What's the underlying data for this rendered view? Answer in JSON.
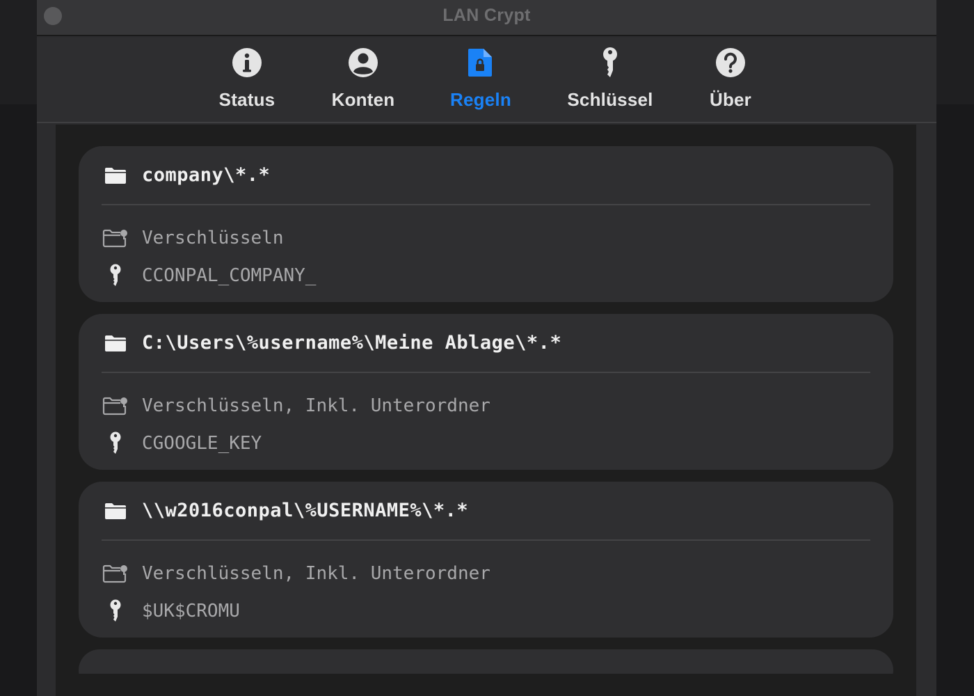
{
  "window": {
    "title": "LAN Crypt"
  },
  "toolbar": {
    "tabs": [
      {
        "label": "Status",
        "icon": "info-circle-icon"
      },
      {
        "label": "Konten",
        "icon": "person-circle-icon"
      },
      {
        "label": "Regeln",
        "icon": "doc-lock-icon",
        "active": true
      },
      {
        "label": "Schlüssel",
        "icon": "key-icon"
      },
      {
        "label": "Über",
        "icon": "question-circle-icon"
      }
    ]
  },
  "rules": [
    {
      "path": "company\\*.*",
      "action": "Verschlüsseln",
      "key": "CCONPAL_COMPANY_"
    },
    {
      "path": "C:\\Users\\%username%\\Meine Ablage\\*.*",
      "action": "Verschlüsseln, Inkl. Unterordner",
      "key": "CGOOGLE_KEY"
    },
    {
      "path": "\\\\w2016conpal\\%USERNAME%\\*.*",
      "action": "Verschlüsseln, Inkl. Unterordner",
      "key": "$UK$CROMU"
    }
  ],
  "colors": {
    "accent": "#1a82f6",
    "background": "#1e1e1e",
    "card": "#2f2f31"
  }
}
